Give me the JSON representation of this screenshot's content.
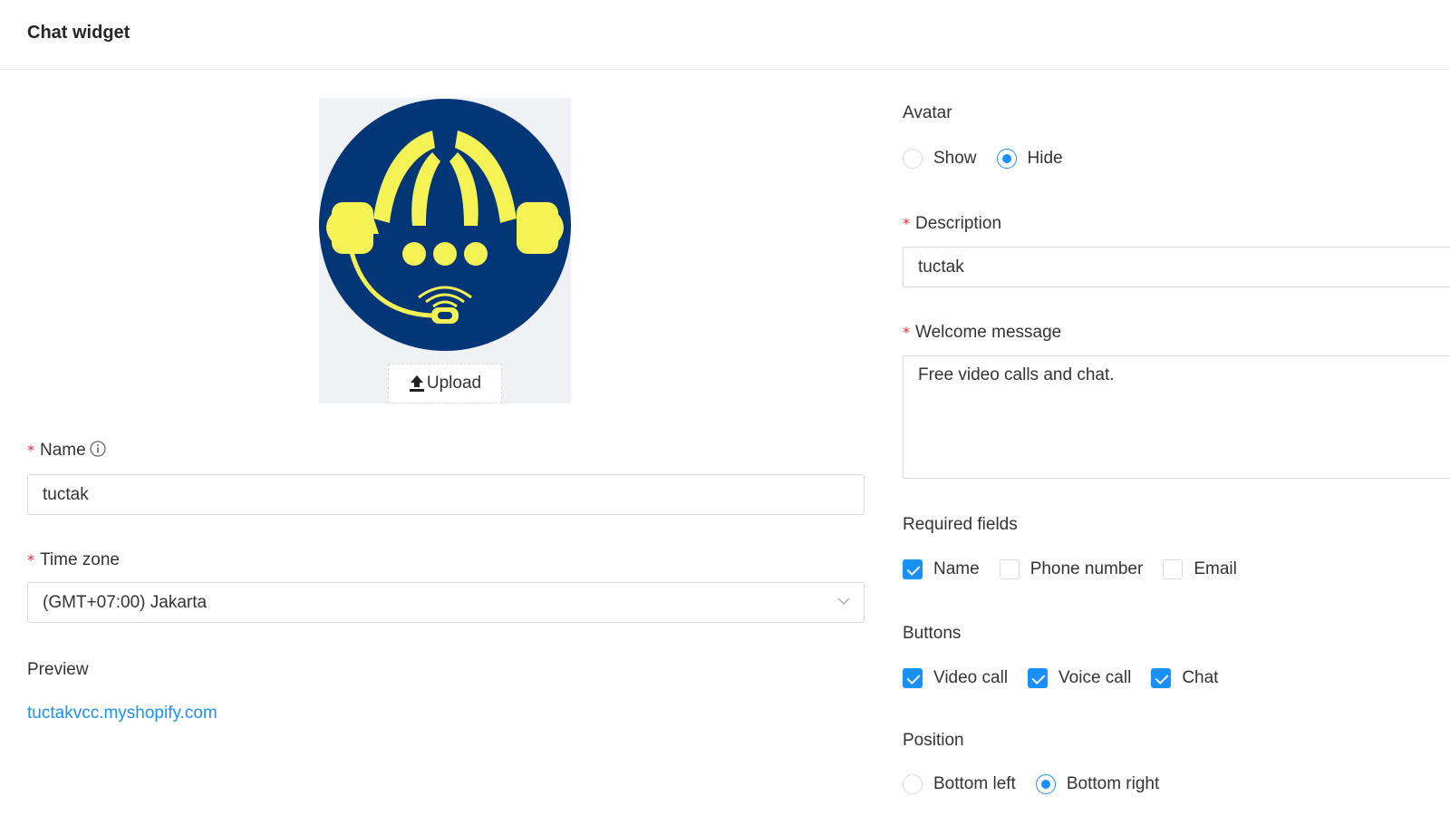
{
  "header": {
    "title": "Chat widget"
  },
  "logo": {
    "upload_label": "Upload",
    "colors": {
      "background": "#033677",
      "foreground": "#f4f254"
    }
  },
  "form": {
    "name": {
      "label": "Name",
      "value": "tuctak",
      "required_mark": "*"
    },
    "timezone": {
      "label": "Time zone",
      "value": "(GMT+07:00) Jakarta",
      "required_mark": "*"
    },
    "preview": {
      "label": "Preview",
      "link": "tuctakvcc.myshopify.com"
    },
    "avatar": {
      "label": "Avatar",
      "options": [
        "Show",
        "Hide"
      ],
      "selected": "Hide"
    },
    "description": {
      "label": "Description",
      "value": "tuctak",
      "required_mark": "*"
    },
    "welcome": {
      "label": "Welcome message",
      "value": "Free video calls and chat.",
      "required_mark": "*"
    },
    "required_fields": {
      "label": "Required fields",
      "options": [
        {
          "label": "Name",
          "checked": true
        },
        {
          "label": "Phone number",
          "checked": false
        },
        {
          "label": "Email",
          "checked": false
        }
      ]
    },
    "buttons": {
      "label": "Buttons",
      "options": [
        {
          "label": "Video call",
          "checked": true
        },
        {
          "label": "Voice call",
          "checked": true
        },
        {
          "label": "Chat",
          "checked": true
        }
      ]
    },
    "position": {
      "label": "Position",
      "options": [
        "Bottom left",
        "Bottom right"
      ],
      "selected": "Bottom right"
    }
  },
  "accent_color": "#1890ff",
  "required_color": "#f5222d"
}
